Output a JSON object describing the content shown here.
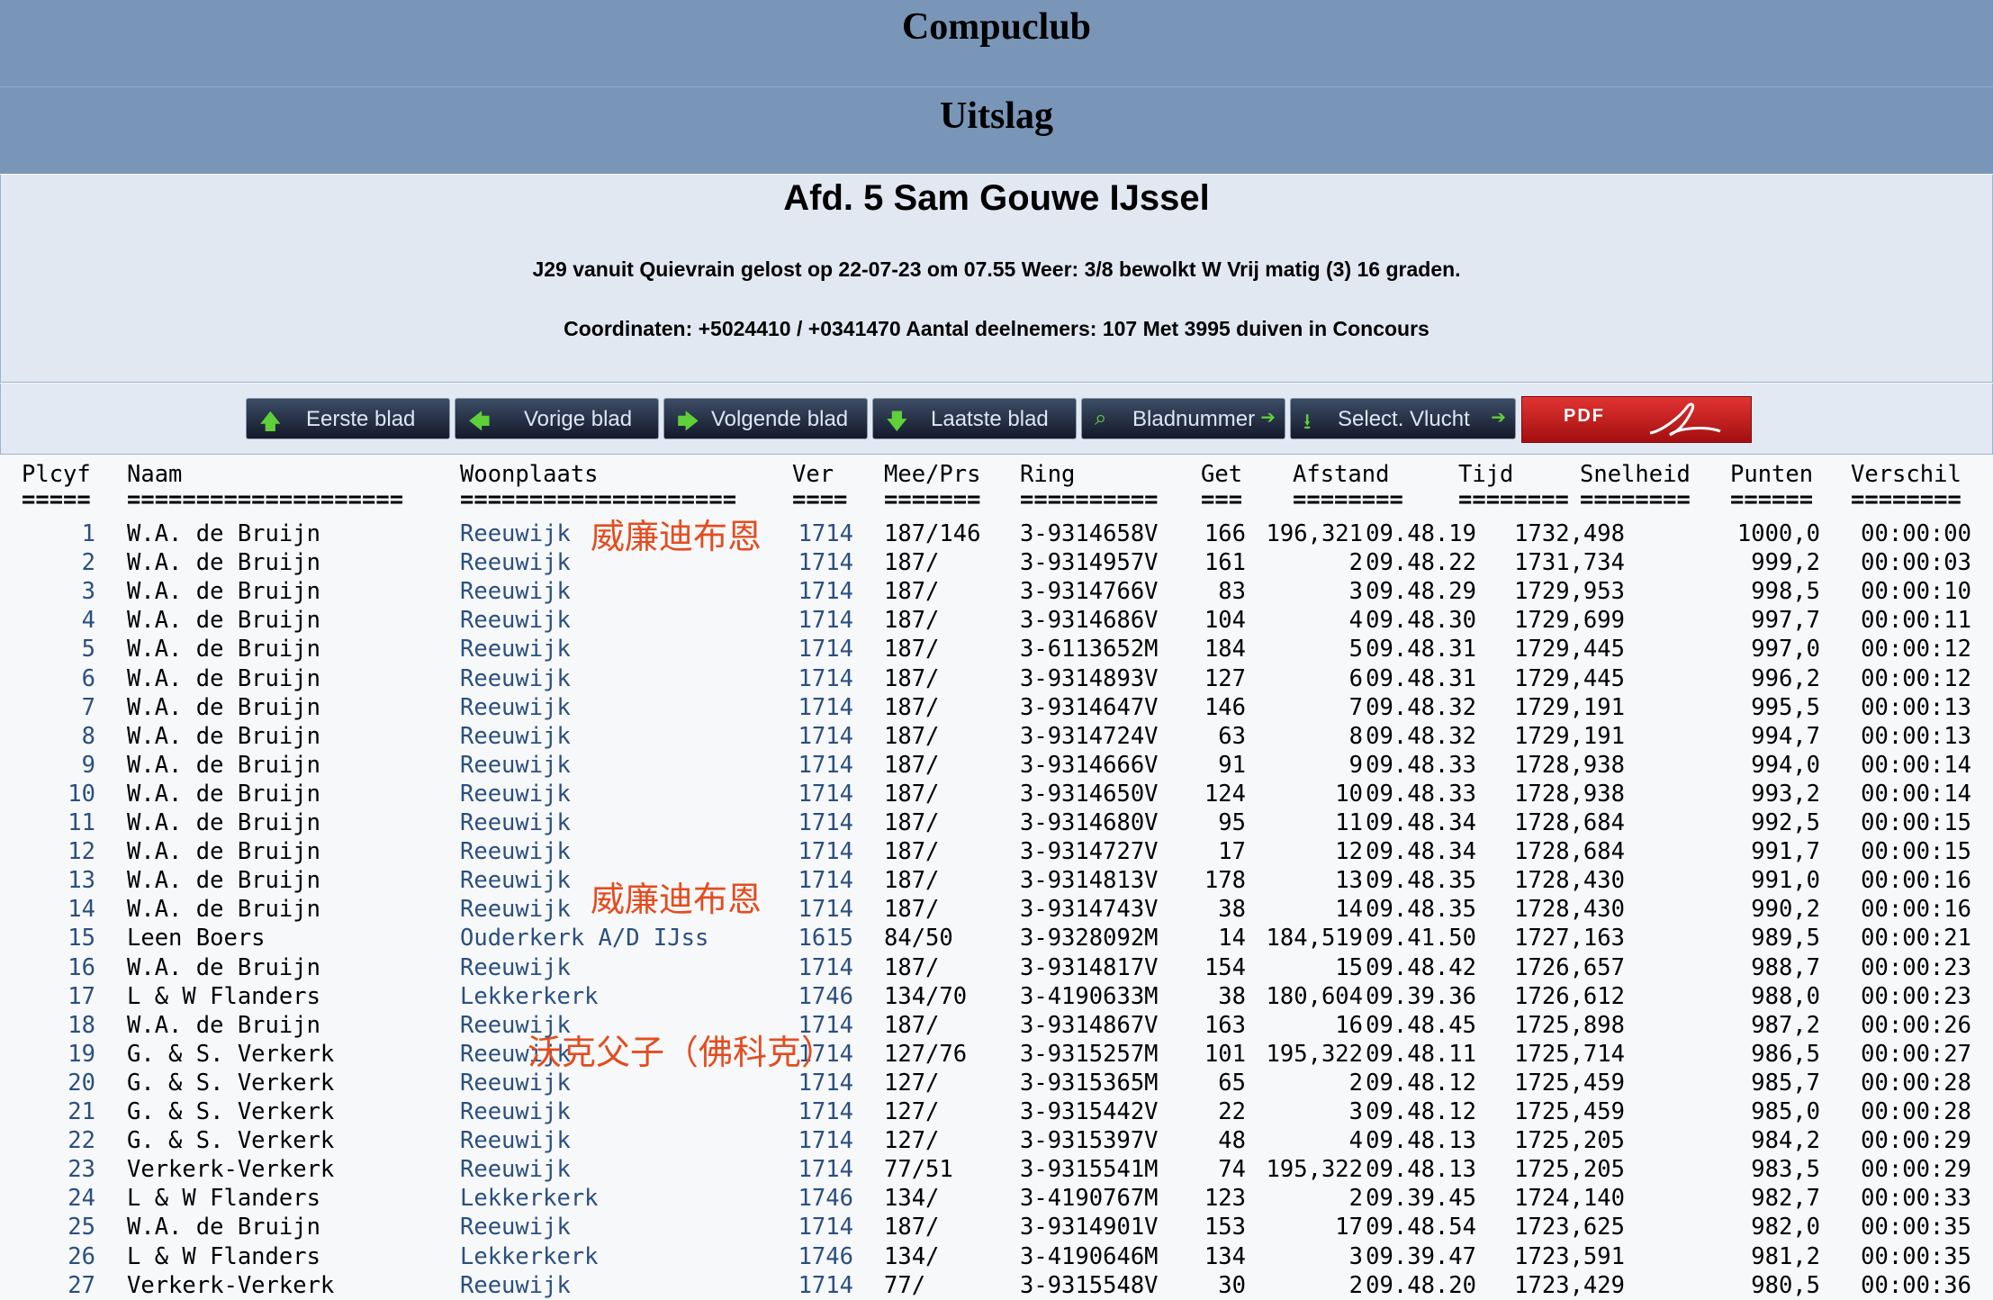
{
  "site_title": "Compuclub",
  "page_title": "Uitslag",
  "info": {
    "heading": "Afd. 5 Sam Gouwe IJssel",
    "line1": "J29 vanuit Quievrain gelost op 22-07-23 om 07.55 Weer: 3/8 bewolkt W Vrij matig (3) 16 graden.",
    "line2": "Coordinaten: +5024410 / +0341470 Aantal deelnemers: 107 Met 3995 duiven in Concours"
  },
  "nav": {
    "first": "Eerste blad",
    "prev": "Vorige blad",
    "next": "Volgende blad",
    "last": "Laatste blad",
    "page": "Bladnummer",
    "select": "Select. Vlucht",
    "pdf": "PDF"
  },
  "watermarks": [
    "威廉迪布恩",
    "威廉迪布恩",
    "沃克父子（佛科克）"
  ],
  "columns": [
    {
      "h": "Plcyf",
      "u": "====="
    },
    {
      "h": "Naam",
      "u": "===================="
    },
    {
      "h": "Woonplaats",
      "u": "===================="
    },
    {
      "h": "Ver",
      "u": "===="
    },
    {
      "h": "Mee/Prs",
      "u": "======="
    },
    {
      "h": "Ring",
      "u": "=========="
    },
    {
      "h": "Get",
      "u": "==="
    },
    {
      "h": "Afstand",
      "u": "========"
    },
    {
      "h": "Tijd",
      "u": "========"
    },
    {
      "h": "Snelheid",
      "u": "========"
    },
    {
      "h": "Punten",
      "u": "======"
    },
    {
      "h": "Verschil",
      "u": "========"
    }
  ],
  "rows": [
    [
      "1",
      "W.A. de Bruijn",
      "Reeuwijk",
      "1714",
      "187/146",
      "3-9314658V",
      "166",
      "196,321",
      "09.48.19",
      "1732,498",
      "1000,0",
      "00:00:00"
    ],
    [
      "2",
      "W.A. de Bruijn",
      "Reeuwijk",
      "1714",
      "187/",
      "3-9314957V",
      "161",
      "2",
      "09.48.22",
      "1731,734",
      "999,2",
      "00:00:03"
    ],
    [
      "3",
      "W.A. de Bruijn",
      "Reeuwijk",
      "1714",
      "187/",
      "3-9314766V",
      "83",
      "3",
      "09.48.29",
      "1729,953",
      "998,5",
      "00:00:10"
    ],
    [
      "4",
      "W.A. de Bruijn",
      "Reeuwijk",
      "1714",
      "187/",
      "3-9314686V",
      "104",
      "4",
      "09.48.30",
      "1729,699",
      "997,7",
      "00:00:11"
    ],
    [
      "5",
      "W.A. de Bruijn",
      "Reeuwijk",
      "1714",
      "187/",
      "3-6113652M",
      "184",
      "5",
      "09.48.31",
      "1729,445",
      "997,0",
      "00:00:12"
    ],
    [
      "6",
      "W.A. de Bruijn",
      "Reeuwijk",
      "1714",
      "187/",
      "3-9314893V",
      "127",
      "6",
      "09.48.31",
      "1729,445",
      "996,2",
      "00:00:12"
    ],
    [
      "7",
      "W.A. de Bruijn",
      "Reeuwijk",
      "1714",
      "187/",
      "3-9314647V",
      "146",
      "7",
      "09.48.32",
      "1729,191",
      "995,5",
      "00:00:13"
    ],
    [
      "8",
      "W.A. de Bruijn",
      "Reeuwijk",
      "1714",
      "187/",
      "3-9314724V",
      "63",
      "8",
      "09.48.32",
      "1729,191",
      "994,7",
      "00:00:13"
    ],
    [
      "9",
      "W.A. de Bruijn",
      "Reeuwijk",
      "1714",
      "187/",
      "3-9314666V",
      "91",
      "9",
      "09.48.33",
      "1728,938",
      "994,0",
      "00:00:14"
    ],
    [
      "10",
      "W.A. de Bruijn",
      "Reeuwijk",
      "1714",
      "187/",
      "3-9314650V",
      "124",
      "10",
      "09.48.33",
      "1728,938",
      "993,2",
      "00:00:14"
    ],
    [
      "11",
      "W.A. de Bruijn",
      "Reeuwijk",
      "1714",
      "187/",
      "3-9314680V",
      "95",
      "11",
      "09.48.34",
      "1728,684",
      "992,5",
      "00:00:15"
    ],
    [
      "12",
      "W.A. de Bruijn",
      "Reeuwijk",
      "1714",
      "187/",
      "3-9314727V",
      "17",
      "12",
      "09.48.34",
      "1728,684",
      "991,7",
      "00:00:15"
    ],
    [
      "13",
      "W.A. de Bruijn",
      "Reeuwijk",
      "1714",
      "187/",
      "3-9314813V",
      "178",
      "13",
      "09.48.35",
      "1728,430",
      "991,0",
      "00:00:16"
    ],
    [
      "14",
      "W.A. de Bruijn",
      "Reeuwijk",
      "1714",
      "187/",
      "3-9314743V",
      "38",
      "14",
      "09.48.35",
      "1728,430",
      "990,2",
      "00:00:16"
    ],
    [
      "15",
      "Leen Boers",
      "Ouderkerk A/D IJss",
      "1615",
      "84/50",
      "3-9328092M",
      "14",
      "184,519",
      "09.41.50",
      "1727,163",
      "989,5",
      "00:00:21"
    ],
    [
      "16",
      "W.A. de Bruijn",
      "Reeuwijk",
      "1714",
      "187/",
      "3-9314817V",
      "154",
      "15",
      "09.48.42",
      "1726,657",
      "988,7",
      "00:00:23"
    ],
    [
      "17",
      "L & W Flanders",
      "Lekkerkerk",
      "1746",
      "134/70",
      "3-4190633M",
      "38",
      "180,604",
      "09.39.36",
      "1726,612",
      "988,0",
      "00:00:23"
    ],
    [
      "18",
      "W.A. de Bruijn",
      "Reeuwijk",
      "1714",
      "187/",
      "3-9314867V",
      "163",
      "16",
      "09.48.45",
      "1725,898",
      "987,2",
      "00:00:26"
    ],
    [
      "19",
      "G. & S. Verkerk",
      "Reeuwijk",
      "1714",
      "127/76",
      "3-9315257M",
      "101",
      "195,322",
      "09.48.11",
      "1725,714",
      "986,5",
      "00:00:27"
    ],
    [
      "20",
      "G. & S. Verkerk",
      "Reeuwijk",
      "1714",
      "127/",
      "3-9315365M",
      "65",
      "2",
      "09.48.12",
      "1725,459",
      "985,7",
      "00:00:28"
    ],
    [
      "21",
      "G. & S. Verkerk",
      "Reeuwijk",
      "1714",
      "127/",
      "3-9315442V",
      "22",
      "3",
      "09.48.12",
      "1725,459",
      "985,0",
      "00:00:28"
    ],
    [
      "22",
      "G. & S. Verkerk",
      "Reeuwijk",
      "1714",
      "127/",
      "3-9315397V",
      "48",
      "4",
      "09.48.13",
      "1725,205",
      "984,2",
      "00:00:29"
    ],
    [
      "23",
      "Verkerk-Verkerk",
      "Reeuwijk",
      "1714",
      "77/51",
      "3-9315541M",
      "74",
      "195,322",
      "09.48.13",
      "1725,205",
      "983,5",
      "00:00:29"
    ],
    [
      "24",
      "L & W Flanders",
      "Lekkerkerk",
      "1746",
      "134/",
      "3-4190767M",
      "123",
      "2",
      "09.39.45",
      "1724,140",
      "982,7",
      "00:00:33"
    ],
    [
      "25",
      "W.A. de Bruijn",
      "Reeuwijk",
      "1714",
      "187/",
      "3-9314901V",
      "153",
      "17",
      "09.48.54",
      "1723,625",
      "982,0",
      "00:00:35"
    ],
    [
      "26",
      "L & W Flanders",
      "Lekkerkerk",
      "1746",
      "134/",
      "3-4190646M",
      "134",
      "3",
      "09.39.47",
      "1723,591",
      "981,2",
      "00:00:35"
    ],
    [
      "27",
      "Verkerk-Verkerk",
      "Reeuwijk",
      "1714",
      "77/",
      "3-9315548V",
      "30",
      "2",
      "09.48.20",
      "1723,429",
      "980,5",
      "00:00:36"
    ]
  ]
}
